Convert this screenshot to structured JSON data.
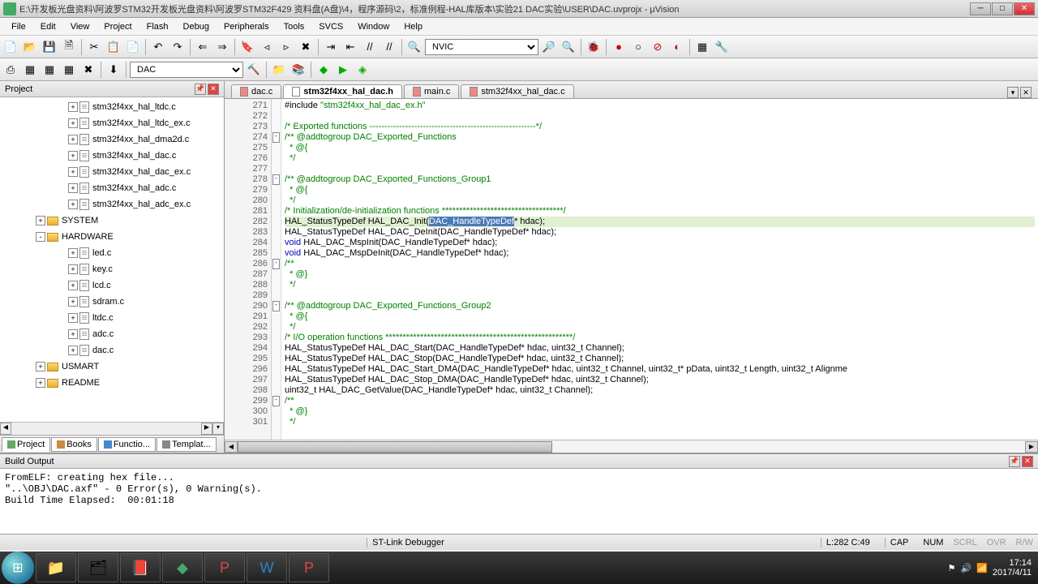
{
  "window": {
    "title": "E:\\开发板光盘资料\\阿波罗STM32开发板光盘资料\\阿波罗STM32F429 资料盘(A盘)\\4，程序源码\\2，标准例程-HAL库版本\\实验21 DAC实验\\USER\\DAC.uvprojx - μVision"
  },
  "menu": {
    "file": "File",
    "edit": "Edit",
    "view": "View",
    "project": "Project",
    "flash": "Flash",
    "debug": "Debug",
    "peripherals": "Peripherals",
    "tools": "Tools",
    "svcs": "SVCS",
    "window": "Window",
    "help": "Help"
  },
  "toolbar": {
    "combo1": "NVIC",
    "target": "DAC"
  },
  "project_panel": {
    "title": "Project",
    "files": [
      "stm32f4xx_hal_ltdc.c",
      "stm32f4xx_hal_ltdc_ex.c",
      "stm32f4xx_hal_dma2d.c",
      "stm32f4xx_hal_dac.c",
      "stm32f4xx_hal_dac_ex.c",
      "stm32f4xx_hal_adc.c",
      "stm32f4xx_hal_adc_ex.c"
    ],
    "folders": [
      {
        "name": "SYSTEM",
        "open": false
      },
      {
        "name": "HARDWARE",
        "open": true,
        "children": [
          "led.c",
          "key.c",
          "lcd.c",
          "sdram.c",
          "ltdc.c",
          "adc.c",
          "dac.c"
        ]
      },
      {
        "name": "USMART",
        "open": false
      },
      {
        "name": "README",
        "open": false
      }
    ],
    "tabs": {
      "project": "Project",
      "books": "Books",
      "functions": "Functio...",
      "templates": "Templat..."
    }
  },
  "editor": {
    "tabs": [
      {
        "label": "dac.c",
        "active": false
      },
      {
        "label": "stm32f4xx_hal_dac.h",
        "active": true
      },
      {
        "label": "main.c",
        "active": false
      },
      {
        "label": "stm32f4xx_hal_dac.c",
        "active": false
      }
    ],
    "line_start": 271,
    "lines": [
      {
        "n": 271,
        "html": "<span class='c-dark'>#include </span><span class='c-green'>\"stm32f4xx_hal_dac_ex.h\"</span>"
      },
      {
        "n": 272,
        "html": ""
      },
      {
        "n": 273,
        "html": "<span class='c-green'>/* Exported functions --------------------------------------------------------*/</span>"
      },
      {
        "n": 274,
        "html": "<span class='c-green'>/** @addtogroup DAC_Exported_Functions</span>",
        "fold": "-"
      },
      {
        "n": 275,
        "html": "<span class='c-green'>  * @{</span>"
      },
      {
        "n": 276,
        "html": "<span class='c-green'>  */</span>"
      },
      {
        "n": 277,
        "html": ""
      },
      {
        "n": 278,
        "html": "<span class='c-green'>/** @addtogroup DAC_Exported_Functions_Group1</span>",
        "fold": "-"
      },
      {
        "n": 279,
        "html": "<span class='c-green'>  * @{</span>"
      },
      {
        "n": 280,
        "html": "<span class='c-green'>  */</span>"
      },
      {
        "n": 281,
        "html": "<span class='c-green'>/* Initialization/de-initialization functions ***********************************/</span>"
      },
      {
        "n": 282,
        "html": "<span class='c-dark'>HAL_StatusTypeDef HAL_DAC_Init(</span><span class='sel'>DAC_HandleTypeDef</span><span class='c-dark'>* hdac);</span>",
        "hl": true
      },
      {
        "n": 283,
        "html": "<span class='c-dark'>HAL_StatusTypeDef HAL_DAC_DeInit(DAC_HandleTypeDef* hdac);</span>"
      },
      {
        "n": 284,
        "html": "<span class='c-blue'>void</span><span class='c-dark'> HAL_DAC_MspInit(DAC_HandleTypeDef* hdac);</span>"
      },
      {
        "n": 285,
        "html": "<span class='c-blue'>void</span><span class='c-dark'> HAL_DAC_MspDeInit(DAC_HandleTypeDef* hdac);</span>"
      },
      {
        "n": 286,
        "html": "<span class='c-green'>/**</span>",
        "fold": "-"
      },
      {
        "n": 287,
        "html": "<span class='c-green'>  * @}</span>"
      },
      {
        "n": 288,
        "html": "<span class='c-green'>  */</span>"
      },
      {
        "n": 289,
        "html": ""
      },
      {
        "n": 290,
        "html": "<span class='c-green'>/** @addtogroup DAC_Exported_Functions_Group2</span>",
        "fold": "-"
      },
      {
        "n": 291,
        "html": "<span class='c-green'>  * @{</span>"
      },
      {
        "n": 292,
        "html": "<span class='c-green'>  */</span>"
      },
      {
        "n": 293,
        "html": "<span class='c-green'>/* I/O operation functions ******************************************************/</span>"
      },
      {
        "n": 294,
        "html": "<span class='c-dark'>HAL_StatusTypeDef HAL_DAC_Start(DAC_HandleTypeDef* hdac, uint32_t Channel);</span>"
      },
      {
        "n": 295,
        "html": "<span class='c-dark'>HAL_StatusTypeDef HAL_DAC_Stop(DAC_HandleTypeDef* hdac, uint32_t Channel);</span>"
      },
      {
        "n": 296,
        "html": "<span class='c-dark'>HAL_StatusTypeDef HAL_DAC_Start_DMA(DAC_HandleTypeDef* hdac, uint32_t Channel, uint32_t* pData, uint32_t Length, uint32_t Alignme</span>"
      },
      {
        "n": 297,
        "html": "<span class='c-dark'>HAL_StatusTypeDef HAL_DAC_Stop_DMA(DAC_HandleTypeDef* hdac, uint32_t Channel);</span>"
      },
      {
        "n": 298,
        "html": "<span class='c-dark'>uint32_t HAL_DAC_GetValue(DAC_HandleTypeDef* hdac, uint32_t Channel);</span>"
      },
      {
        "n": 299,
        "html": "<span class='c-green'>/**</span>",
        "fold": "-"
      },
      {
        "n": 300,
        "html": "<span class='c-green'>  * @}</span>"
      },
      {
        "n": 301,
        "html": "<span class='c-green'>  */</span>"
      }
    ]
  },
  "build": {
    "title": "Build Output",
    "text": "FromELF: creating hex file...\n\"..\\OBJ\\DAC.axf\" - 0 Error(s), 0 Warning(s).\nBuild Time Elapsed:  00:01:18"
  },
  "status": {
    "debugger": "ST-Link Debugger",
    "pos": "L:282 C:49",
    "cap": "CAP",
    "num": "NUM",
    "scrl": "SCRL",
    "ovr": "OVR",
    "rw": "R/W"
  },
  "taskbar": {
    "time": "17:14",
    "date": "2017/4/11"
  }
}
